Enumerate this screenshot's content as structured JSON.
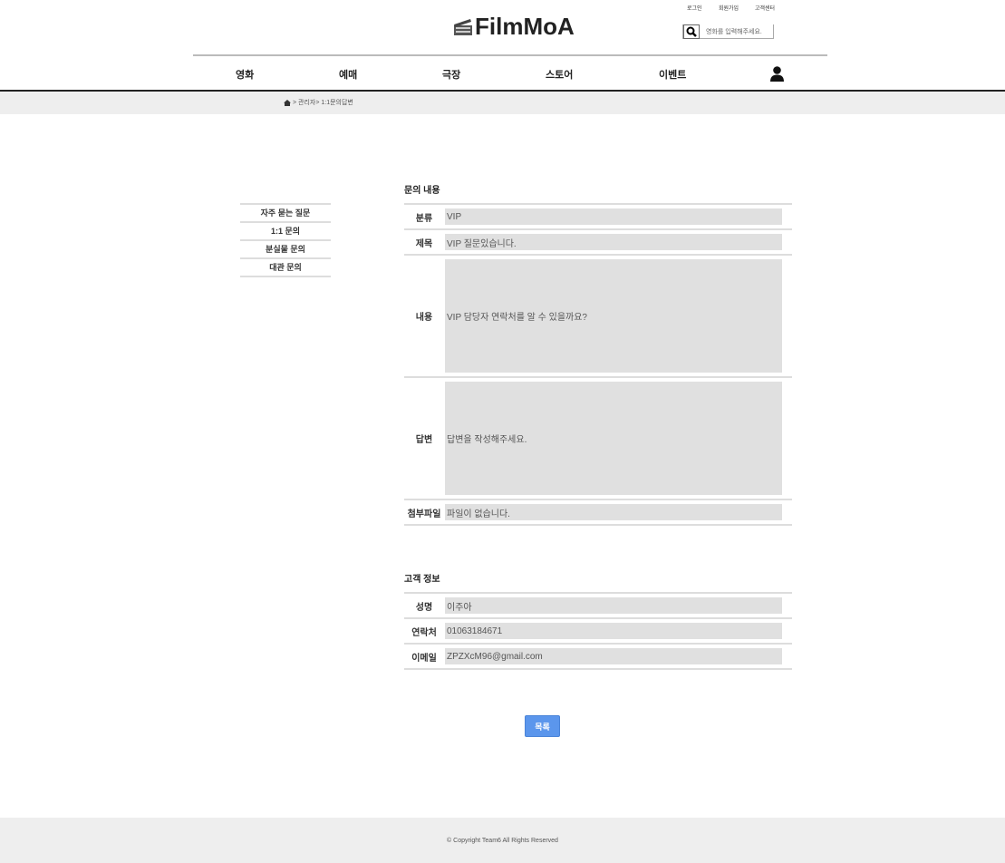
{
  "header": {
    "logo": "FilmMoA",
    "links": [
      "로그인",
      "회원가입",
      "고객센터"
    ],
    "search_placeholder": "영화를 입력해주세요."
  },
  "nav": {
    "items": [
      "영화",
      "예매",
      "극장",
      "스토어",
      "이벤트"
    ]
  },
  "breadcrumb": {
    "text": "> 관리자> 1:1문의답변"
  },
  "sidebar": {
    "items": [
      "자주 묻는 질문",
      "1:1 문의",
      "분실물 문의",
      "대관 문의"
    ]
  },
  "inquiry": {
    "title": "문의 내용",
    "rows": [
      {
        "label": "분류",
        "value": "VIP"
      },
      {
        "label": "제목",
        "value": "VIP 질문있습니다."
      },
      {
        "label": "내용",
        "value": "VIP 담당자 연락처를 알 수 있을까요?"
      },
      {
        "label": "답변",
        "value": "답변을 작성해주세요."
      },
      {
        "label": "첨부파일",
        "value": "파일이 없습니다."
      }
    ]
  },
  "customer": {
    "title": "고객 정보",
    "rows": [
      {
        "label": "성명",
        "value": "이주아"
      },
      {
        "label": "연락처",
        "value": "01063184671"
      },
      {
        "label": "이메일",
        "value": "ZPZXcM96@gmail.com"
      }
    ]
  },
  "list_button": "목록",
  "footer": "© Copyright Team6 All Rights Reserved",
  "colors": {
    "accent": "#5b96ec",
    "band": "#eeeeee"
  }
}
